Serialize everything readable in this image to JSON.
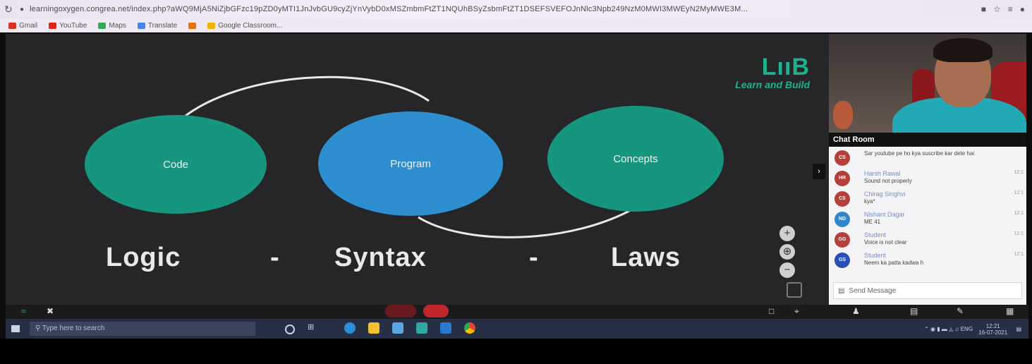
{
  "browser": {
    "url": "learningoxygen.congrea.net/index.php?aWQ9MjA5NiZjbGFzc19pZD0yMTI1JnJvbGU9cyZjYnVybD0xMSZmbmFtZT1NQUhBSyZsbmFtZT1DSEFSVEFOJnNlc3Npb249NzM0MWI3MWEyN2MyMWE3M..."
  },
  "bookmarks": [
    {
      "label": "Gmail",
      "color": "#d93025"
    },
    {
      "label": "YouTube",
      "color": "#e62117"
    },
    {
      "label": "Maps",
      "color": "#34a853"
    },
    {
      "label": "Translate",
      "color": "#4285f4"
    },
    {
      "label": "",
      "color": "#e8710a"
    },
    {
      "label": "Google Classroom...",
      "color": "#f2b200"
    }
  ],
  "slide": {
    "logo_mark": "LııB",
    "logo_tagline": "Learn and Build",
    "circles": {
      "code": "Code",
      "program": "Program",
      "concepts": "Concepts"
    },
    "words": {
      "logic": "Logic",
      "dash1": "-",
      "syntax": "Syntax",
      "dash2": "-",
      "laws": "Laws"
    },
    "accent_green": "#16967e",
    "accent_blue": "#2d8fcf"
  },
  "chat": {
    "title": "Chat Room",
    "messages": [
      {
        "initials": "CS",
        "color": "#b5403a",
        "name": "",
        "text": "Sar youtube pe ho kya suscribe kar dete hai",
        "time": ""
      },
      {
        "initials": "HR",
        "color": "#b5403a",
        "name": "Harsh Rawal",
        "text": "Sound not properly",
        "time": "12:1"
      },
      {
        "initials": "CS",
        "color": "#b5403a",
        "name": "Chirag Singhvi",
        "text": "kya*",
        "time": "12:1"
      },
      {
        "initials": "ND",
        "color": "#2f86c8",
        "name": "Nishant Dagar",
        "text": "ME 41",
        "time": "12:1"
      },
      {
        "initials": "GG",
        "color": "#b5403a",
        "name": "Student",
        "text": "Voice is not clear",
        "time": "12:1"
      },
      {
        "initials": "GS",
        "color": "#2b4fb8",
        "name": "Student",
        "text": "Neem ka patta kadwa h",
        "time": "12:1"
      }
    ],
    "send_placeholder": "Send Message"
  },
  "taskbar": {
    "search_placeholder": "Type here to search",
    "tray_lang": "ENG",
    "time": "12:21",
    "date": "16-07-2021"
  }
}
